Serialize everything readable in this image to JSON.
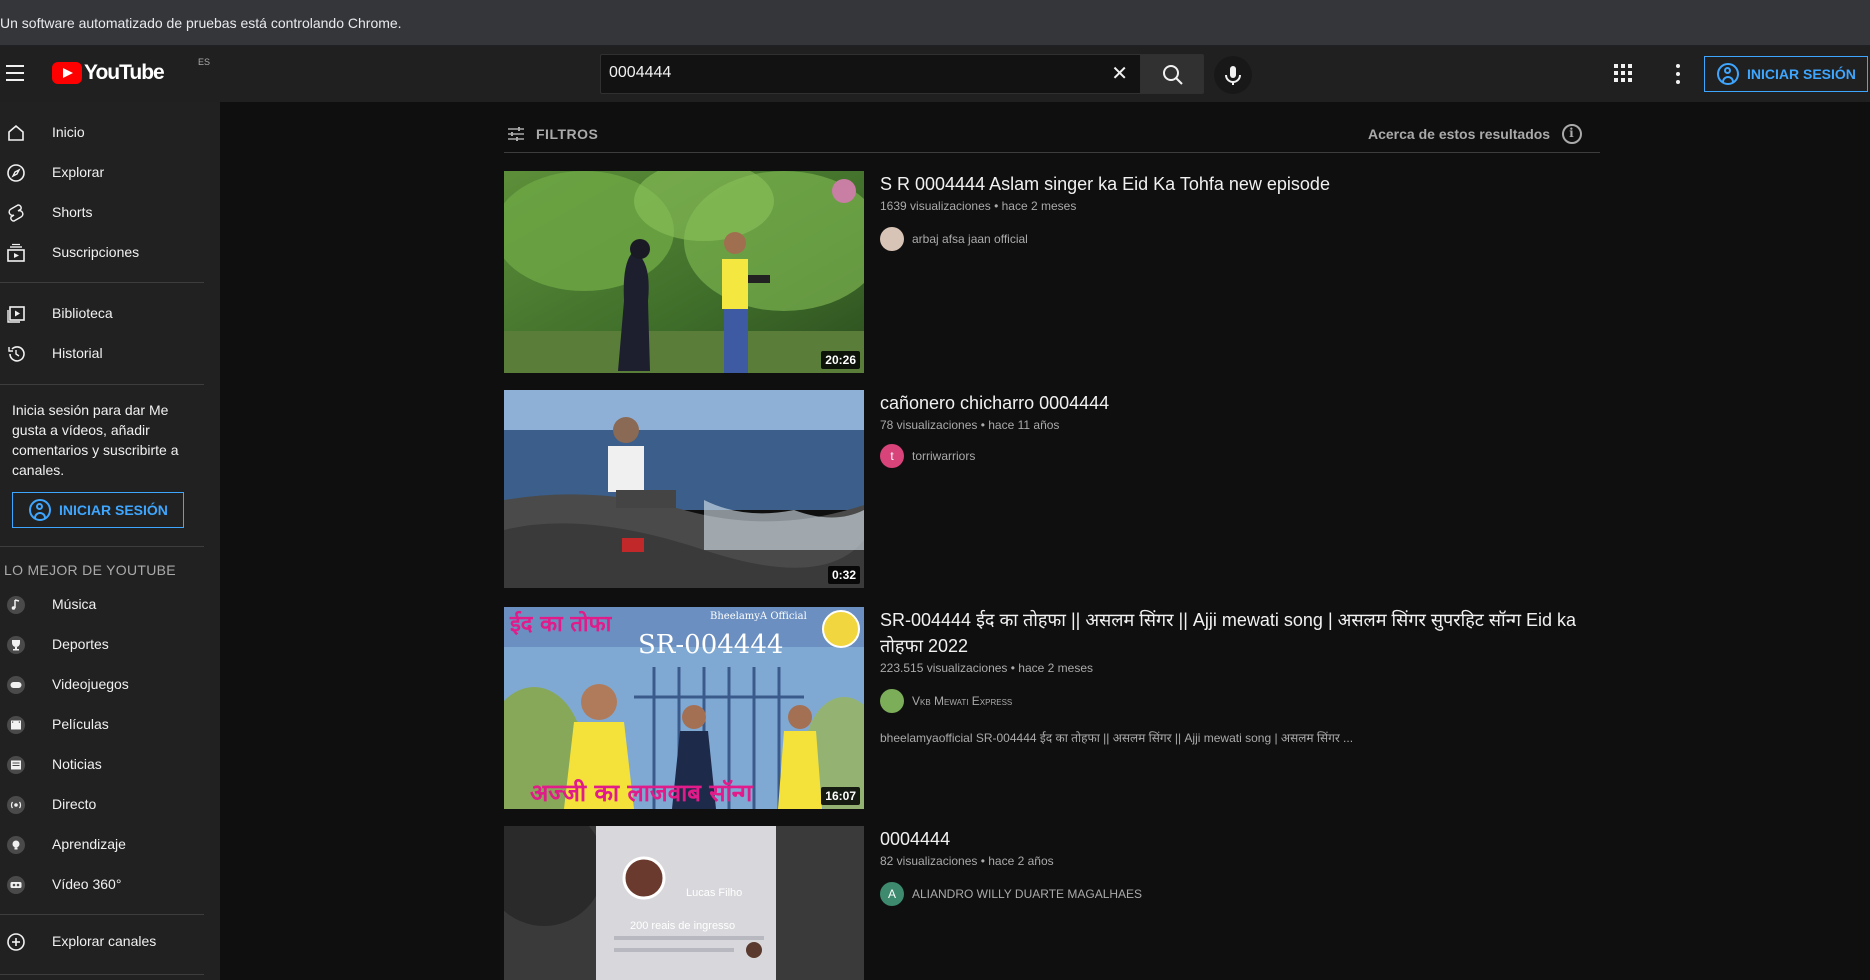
{
  "browser": {
    "infobar_text": "Un software automatizado de pruebas está controlando Chrome."
  },
  "masthead": {
    "logo_text": "YouTube",
    "country_code": "ES",
    "search_value": "0004444",
    "signin_label": "INICIAR SESIÓN"
  },
  "sidebar": {
    "items": [
      {
        "label": "Inicio",
        "icon": "home-icon"
      },
      {
        "label": "Explorar",
        "icon": "compass-icon"
      },
      {
        "label": "Shorts",
        "icon": "shorts-icon"
      },
      {
        "label": "Suscripciones",
        "icon": "subscriptions-icon"
      },
      {
        "label": "Biblioteca",
        "icon": "library-icon"
      },
      {
        "label": "Historial",
        "icon": "history-icon"
      }
    ],
    "signin_promo": "Inicia sesión para dar Me gusta a vídeos, añadir comentarios y suscribirte a canales.",
    "signin_label": "INICIAR SESIÓN",
    "best_of_heading": "LO MEJOR DE YOUTUBE",
    "best_of": [
      {
        "label": "Música",
        "icon": "music-icon"
      },
      {
        "label": "Deportes",
        "icon": "trophy-icon"
      },
      {
        "label": "Videojuegos",
        "icon": "gaming-icon"
      },
      {
        "label": "Películas",
        "icon": "movies-icon"
      },
      {
        "label": "Noticias",
        "icon": "news-icon"
      },
      {
        "label": "Directo",
        "icon": "live-icon"
      },
      {
        "label": "Aprendizaje",
        "icon": "learning-icon"
      },
      {
        "label": "Vídeo 360°",
        "icon": "video360-icon"
      }
    ],
    "explore_channels": "Explorar canales"
  },
  "results": {
    "filters_label": "FILTROS",
    "about_label": "Acerca de estos resultados",
    "videos": [
      {
        "title": "S R 0004444 Aslam singer ka Eid Ka Tohfa new episode",
        "meta": "1639 visualizaciones • hace 2 meses",
        "channel": "arbaj afsa jaan official",
        "duration": "20:26",
        "avatar_letter": "",
        "avatar_color": "#d8c4b6"
      },
      {
        "title": "cañonero chicharro 0004444",
        "meta": "78 visualizaciones • hace 11 años",
        "channel": "torriwarriors",
        "duration": "0:32",
        "avatar_letter": "t",
        "avatar_color": "#d8437a"
      },
      {
        "title": "SR-004444 ईद का तोहफा || असलम सिंगर || Ajji mewati song | असलम सिंगर सुपरहिट सॉन्ग Eid ka तोहफा 2022",
        "meta": "223.515 visualizaciones • hace 2 meses",
        "channel": "Vkb Mewati Express",
        "duration": "16:07",
        "description": "bheelamyaofficial SR-004444 ईद का तोहफा || असलम सिंगर || Ajji mewati song | असलम सिंगर ...",
        "avatar_letter": "",
        "avatar_color": "#7cae5a",
        "thumb_text_top_left": "ईद का तोफा",
        "thumb_text_center": "SR-004444",
        "thumb_text_brand": "BheelamyA Official",
        "thumb_text_bottom": "अज्जी का लाजवाब सॉन्ग"
      },
      {
        "title": "0004444",
        "meta": "82 visualizaciones • hace 2 años",
        "channel": "ALIANDRO WILLY DUARTE MAGALHAES",
        "duration": "",
        "avatar_letter": "A",
        "avatar_color": "#3d8a6e",
        "thumb_text_name": "Lucas Filho",
        "thumb_text_caption": "200 reais de ingresso"
      }
    ]
  },
  "colors": {
    "accent_blue": "#3ea6ff",
    "brand_red": "#ff0000",
    "background": "#0f0f0f",
    "sidebar": "#212121"
  }
}
